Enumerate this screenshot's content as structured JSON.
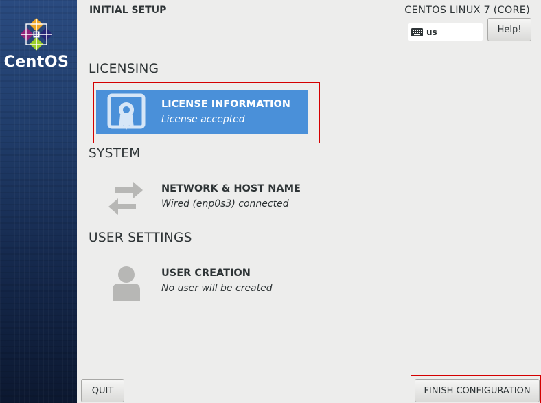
{
  "brand": {
    "name": "CentOS"
  },
  "header": {
    "title": "INITIAL SETUP",
    "product": "CENTOS LINUX 7 (CORE)",
    "keyboard_layout": "us",
    "help_label": "Help!"
  },
  "sections": [
    {
      "title": "LICENSING",
      "spokes": [
        {
          "title": "LICENSE INFORMATION",
          "status": "License accepted",
          "icon": "license-icon",
          "selected": true
        }
      ]
    },
    {
      "title": "SYSTEM",
      "spokes": [
        {
          "title": "NETWORK & HOST NAME",
          "status": "Wired (enp0s3) connected",
          "icon": "network-arrows-icon"
        }
      ]
    },
    {
      "title": "USER SETTINGS",
      "spokes": [
        {
          "title": "USER CREATION",
          "status": "No user will be created",
          "icon": "user-icon"
        }
      ]
    }
  ],
  "footer": {
    "quit_label": "QUIT",
    "finish_label": "FINISH CONFIGURATION"
  },
  "colors": {
    "sidebar_top": "#2a4b80",
    "sidebar_bottom": "#0c1830",
    "selected_spoke": "#4a90d9",
    "highlight_box": "#d40000",
    "background": "#ededec"
  }
}
